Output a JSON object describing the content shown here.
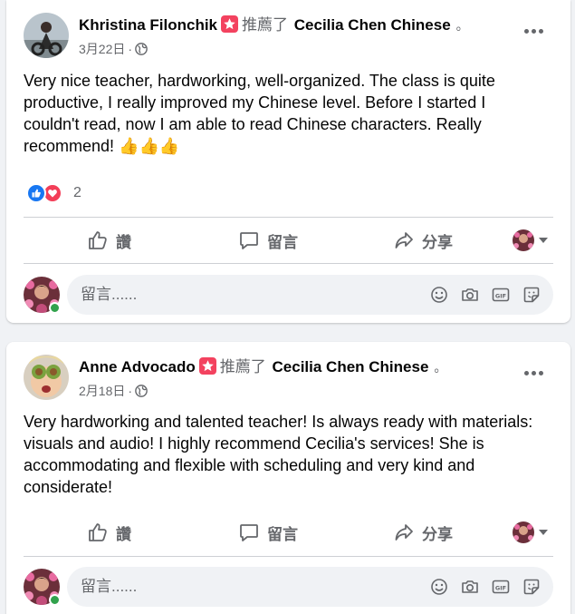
{
  "posts": [
    {
      "author": "Khristina Filonchik",
      "recommends_label": "推薦了",
      "page_name": "Cecilia Chen Chinese",
      "trailing_dot": "。",
      "date": "3月22日",
      "separator": "·",
      "privacy_icon": "globe-icon",
      "body": "Very nice teacher, hardworking, well-organized. The class is quite productive, I really improved my Chinese level. Before I started I couldn't read, now I am able to read Chinese characters. Really recommend! 👍👍👍",
      "reaction_count": "2",
      "reaction_icons": [
        "like-icon",
        "love-icon"
      ],
      "actions": {
        "like": "讚",
        "comment": "留言",
        "share": "分享"
      },
      "comment_placeholder": "留言......"
    },
    {
      "author": "Anne Advocado",
      "recommends_label": "推薦了",
      "page_name": "Cecilia Chen Chinese",
      "trailing_dot": "。",
      "date": "2月18日",
      "separator": "·",
      "privacy_icon": "globe-icon",
      "body": "Very hardworking and talented teacher! Is always ready with materials: visuals and audio! I highly recommend Cecilia's services! She is accommodating and flexible with scheduling and very kind and considerate!",
      "actions": {
        "like": "讚",
        "comment": "留言",
        "share": "分享"
      },
      "comment_placeholder": "留言......"
    }
  ],
  "colors": {
    "page_bg": "#f0f2f5",
    "secondary_text": "#65676b",
    "like_blue": "#1877f2",
    "love_red": "#f33e58",
    "recommend_badge": "#f3425f",
    "online_green": "#31a24c"
  }
}
